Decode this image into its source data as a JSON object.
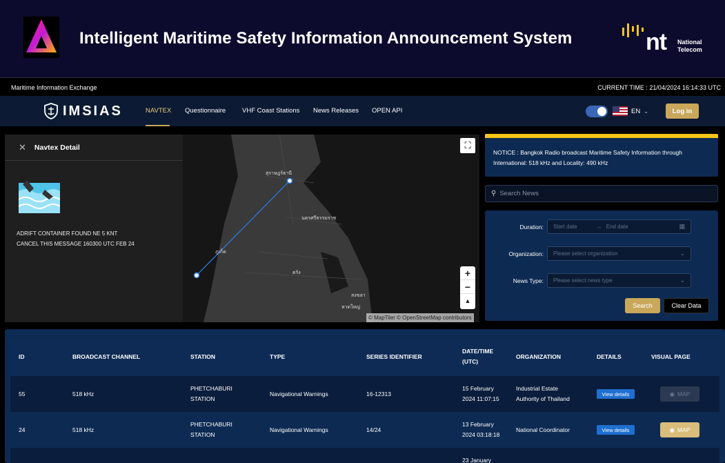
{
  "banner": {
    "title": "Intelligent Maritime Safety Information Announcement System",
    "partner_name_line1": "National",
    "partner_name_line2": "Telecom",
    "partner_logo_text": "nt"
  },
  "infobar": {
    "left": "Maritime Information Exchange",
    "current_time": "CURRENT TIME : 21/04/2024 16:14:33 UTC"
  },
  "nav": {
    "brand": "IMSIAS",
    "items": [
      "NAVTEX",
      "Questionnaire",
      "VHF Coast Stations",
      "News Releases",
      "OPEN API"
    ],
    "active": "NAVTEX",
    "language": "EN",
    "login": "Log in"
  },
  "detail": {
    "title": "Navtex Detail",
    "message_line1": "ADRIFT CONTAINER FOUND NE 5 KNT",
    "message_line2": "CANCEL THIS MESSAGE 160300 UTC FEB 24"
  },
  "map": {
    "labels": [
      "สุราษฎร์ธานี",
      "นครศรีธรรมราช",
      "ภูเก็ต",
      "ตรัง",
      "สงขลา",
      "หาดใหญ่"
    ],
    "attribution": "© MapTiler © OpenStreetMap contributors"
  },
  "notice": {
    "text": "NOTICE : Bangkok Radio broadcast Maritime Safety Information through International: 518 kHz and Locality: 490 kHz"
  },
  "search": {
    "placeholder": "Search News"
  },
  "filters": {
    "duration_label": "Duration:",
    "start_placeholder": "Start date",
    "end_placeholder": "End date",
    "organization_label": "Organization:",
    "organization_placeholder": "Please select organization",
    "news_type_label": "News Type:",
    "news_type_placeholder": "Please select news type",
    "search_button": "Search",
    "clear_button": "Clear Data"
  },
  "table": {
    "headers": {
      "id": "ID",
      "channel": "BROADCAST CHANNEL",
      "station": "STATION",
      "type": "TYPE",
      "series": "SERIES IDENTIFIER",
      "date_l1": "DATE/TIME",
      "date_l2": "(UTC)",
      "org": "ORGANIZATION",
      "details": "DETAILS",
      "visual": "VISUAL PAGE"
    },
    "rows": [
      {
        "id": "55",
        "channel": "518 kHz",
        "station_l1": "PHETCHABURI",
        "station_l2": "STATION",
        "type": "Navigational Warnings",
        "series": "16-12313",
        "date_l1": "15 February",
        "date_l2": "2024 11:07:15",
        "org_l1": "Industrial Estate",
        "org_l2": "Authority of Thailand",
        "details": "View details",
        "map": "MAP",
        "map_enabled": false
      },
      {
        "id": "24",
        "channel": "518 kHz",
        "station_l1": "PHETCHABURI",
        "station_l2": "STATION",
        "type": "Navigational Warnings",
        "series": "14/24",
        "date_l1": "13 February",
        "date_l2": "2024 03:18:18",
        "org_l1": "National Coordinator",
        "org_l2": "",
        "details": "View details",
        "map": "MAP",
        "map_enabled": true
      },
      {
        "date_l1": "23 January"
      }
    ]
  },
  "colors": {
    "accent": "#c9a75b",
    "nav_bg": "#0c1b33",
    "panel_bg": "#0d2a52",
    "notice_bar": "#f5c518",
    "details_blue": "#1f6fd1"
  }
}
